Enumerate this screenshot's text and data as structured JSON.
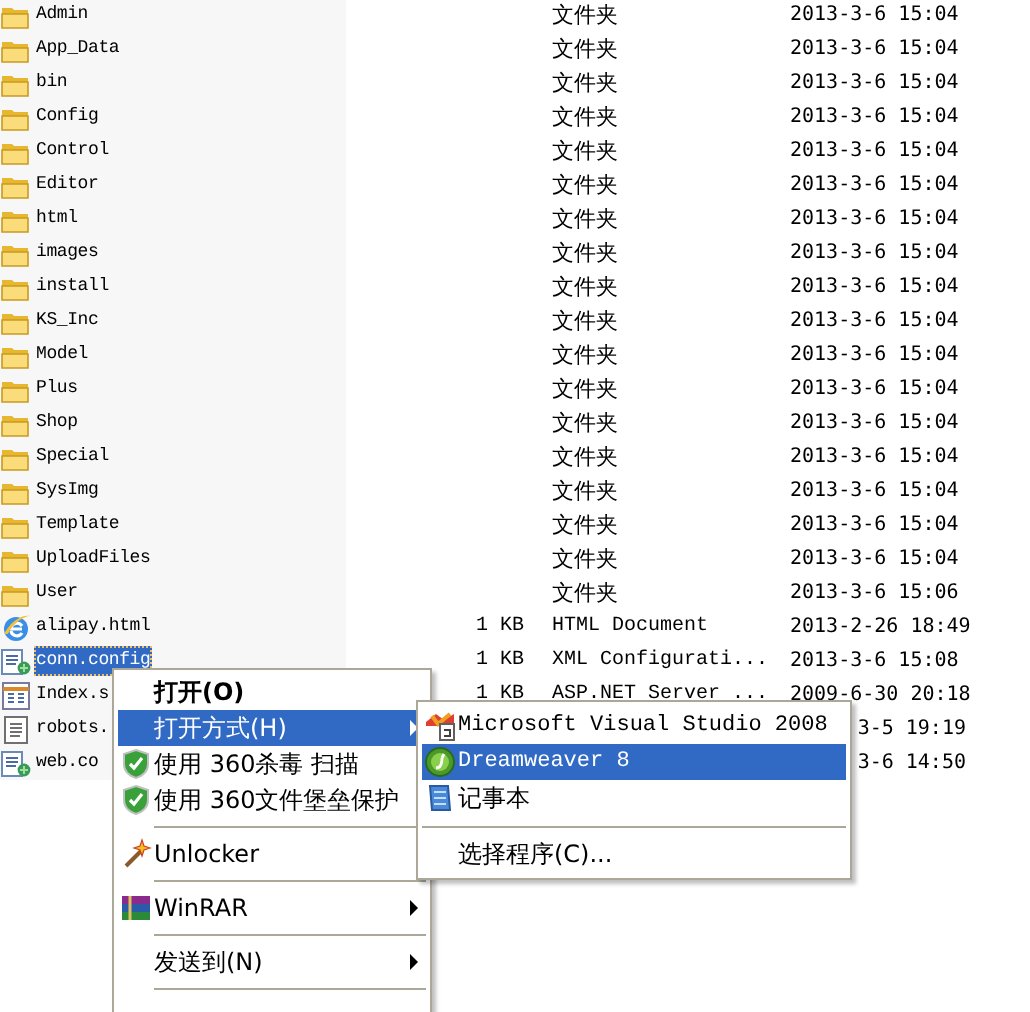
{
  "files": [
    {
      "name": "Admin",
      "kind": "folder",
      "type": "文件夹",
      "date": "2013-3-6 15:04",
      "selected": false
    },
    {
      "name": "App_Data",
      "kind": "folder",
      "type": "文件夹",
      "date": "2013-3-6 15:04",
      "selected": false
    },
    {
      "name": "bin",
      "kind": "folder",
      "type": "文件夹",
      "date": "2013-3-6 15:04",
      "selected": false
    },
    {
      "name": "Config",
      "kind": "folder",
      "type": "文件夹",
      "date": "2013-3-6 15:04",
      "selected": false
    },
    {
      "name": "Control",
      "kind": "folder",
      "type": "文件夹",
      "date": "2013-3-6 15:04",
      "selected": false
    },
    {
      "name": "Editor",
      "kind": "folder",
      "type": "文件夹",
      "date": "2013-3-6 15:04",
      "selected": false
    },
    {
      "name": "html",
      "kind": "folder",
      "type": "文件夹",
      "date": "2013-3-6 15:04",
      "selected": false
    },
    {
      "name": "images",
      "kind": "folder",
      "type": "文件夹",
      "date": "2013-3-6 15:04",
      "selected": false
    },
    {
      "name": "install",
      "kind": "folder",
      "type": "文件夹",
      "date": "2013-3-6 15:04",
      "selected": false
    },
    {
      "name": "KS_Inc",
      "kind": "folder",
      "type": "文件夹",
      "date": "2013-3-6 15:04",
      "selected": false
    },
    {
      "name": "Model",
      "kind": "folder",
      "type": "文件夹",
      "date": "2013-3-6 15:04",
      "selected": false
    },
    {
      "name": "Plus",
      "kind": "folder",
      "type": "文件夹",
      "date": "2013-3-6 15:04",
      "selected": false
    },
    {
      "name": "Shop",
      "kind": "folder",
      "type": "文件夹",
      "date": "2013-3-6 15:04",
      "selected": false
    },
    {
      "name": "Special",
      "kind": "folder",
      "type": "文件夹",
      "date": "2013-3-6 15:04",
      "selected": false
    },
    {
      "name": "SysImg",
      "kind": "folder",
      "type": "文件夹",
      "date": "2013-3-6 15:04",
      "selected": false
    },
    {
      "name": "Template",
      "kind": "folder",
      "type": "文件夹",
      "date": "2013-3-6 15:04",
      "selected": false
    },
    {
      "name": "UploadFiles",
      "kind": "folder",
      "type": "文件夹",
      "date": "2013-3-6 15:04",
      "selected": false
    },
    {
      "name": "User",
      "kind": "folder",
      "type": "文件夹",
      "date": "2013-3-6 15:06",
      "selected": false
    },
    {
      "name": "alipay.html",
      "kind": "web",
      "size": "1 KB",
      "type": "HTML Document",
      "date": "2013-2-26 18:49",
      "selected": false
    },
    {
      "name": "conn.config",
      "kind": "config",
      "size": "1 KB",
      "type": "XML Configurati...",
      "date": "2013-3-6 15:08",
      "selected": true
    },
    {
      "name": "Index.s",
      "kind": "page",
      "size": "1 KB",
      "type": "ASP.NET Server ...",
      "date": "2009-6-30 20:18",
      "selected": false
    },
    {
      "name": "robots.",
      "kind": "text",
      "date": "3-5 19:19",
      "covered": true,
      "selected": false
    },
    {
      "name": "web.co",
      "kind": "config",
      "date": "3-6 14:50",
      "covered": true,
      "selected": false
    }
  ],
  "context_menu": [
    {
      "kind": "default",
      "label": "打开(O)",
      "selected": false
    },
    {
      "kind": "submenu",
      "label": "打开方式(H)",
      "selected": true
    },
    {
      "kind": "antivirus",
      "label": "使用 360杀毒 扫描",
      "selected": false
    },
    {
      "kind": "antivirus",
      "label": "使用 360文件堡垒保护",
      "selected": false
    },
    {
      "kind": "separator"
    },
    {
      "kind": "unlocker",
      "label": "Unlocker",
      "selected": false
    },
    {
      "kind": "separator"
    },
    {
      "kind": "archive",
      "label": "WinRAR",
      "selected": false
    },
    {
      "kind": "separator"
    },
    {
      "kind": "submenu",
      "label": "发送到(N)",
      "selected": false
    },
    {
      "kind": "separator"
    }
  ],
  "open_with_menu": [
    {
      "kind": "studio",
      "label": "Microsoft Visual Studio 2008",
      "selected": false
    },
    {
      "kind": "dreamweaver",
      "label": "Dreamweaver 8",
      "selected": true
    },
    {
      "kind": "notepad",
      "label": "记事本",
      "selected": false
    },
    {
      "kind": "separator"
    },
    {
      "kind": "plain",
      "label": "选择程序(C)...",
      "selected": false
    }
  ]
}
